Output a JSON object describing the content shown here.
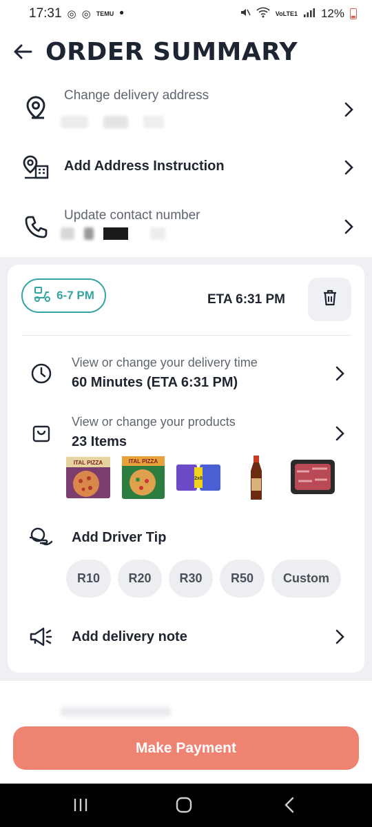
{
  "status_bar": {
    "time": "17:31",
    "temu_label": "TEMU",
    "network_label": "VoLTE1",
    "battery": "12%"
  },
  "header": {
    "title": "ORDER SUMMARY"
  },
  "address": {
    "label": "Change delivery address"
  },
  "instruction": {
    "label": "Add Address Instruction"
  },
  "contact": {
    "label": "Update contact number"
  },
  "delivery_card": {
    "slot": "6-7 PM",
    "eta": "ETA 6:31 PM",
    "time_row": {
      "label": "View or change your delivery time",
      "value": "60 Minutes (ETA 6:31 PM)"
    },
    "products_row": {
      "label": "View or change your products",
      "value": "23 Items"
    },
    "product_thumbnails": [
      {
        "name": "ital-pizza-box",
        "text": "ITAL PIZZA"
      },
      {
        "name": "ital-pizza-box-2",
        "text": "ITAL PIZZA"
      },
      {
        "name": "pads-pack",
        "text": "2x8"
      },
      {
        "name": "sauce-bottle",
        "text": ""
      },
      {
        "name": "meat-tray",
        "text": ""
      }
    ],
    "tip": {
      "label": "Add Driver Tip",
      "options": [
        "R10",
        "R20",
        "R30",
        "R50",
        "Custom"
      ]
    },
    "note": {
      "label": "Add delivery note"
    }
  },
  "pay_button": "Make Payment",
  "colors": {
    "accent_teal": "#31a3a0",
    "pay_button": "#ef8372",
    "text_dark": "#1f2530",
    "background_gray": "#eef0f4"
  }
}
